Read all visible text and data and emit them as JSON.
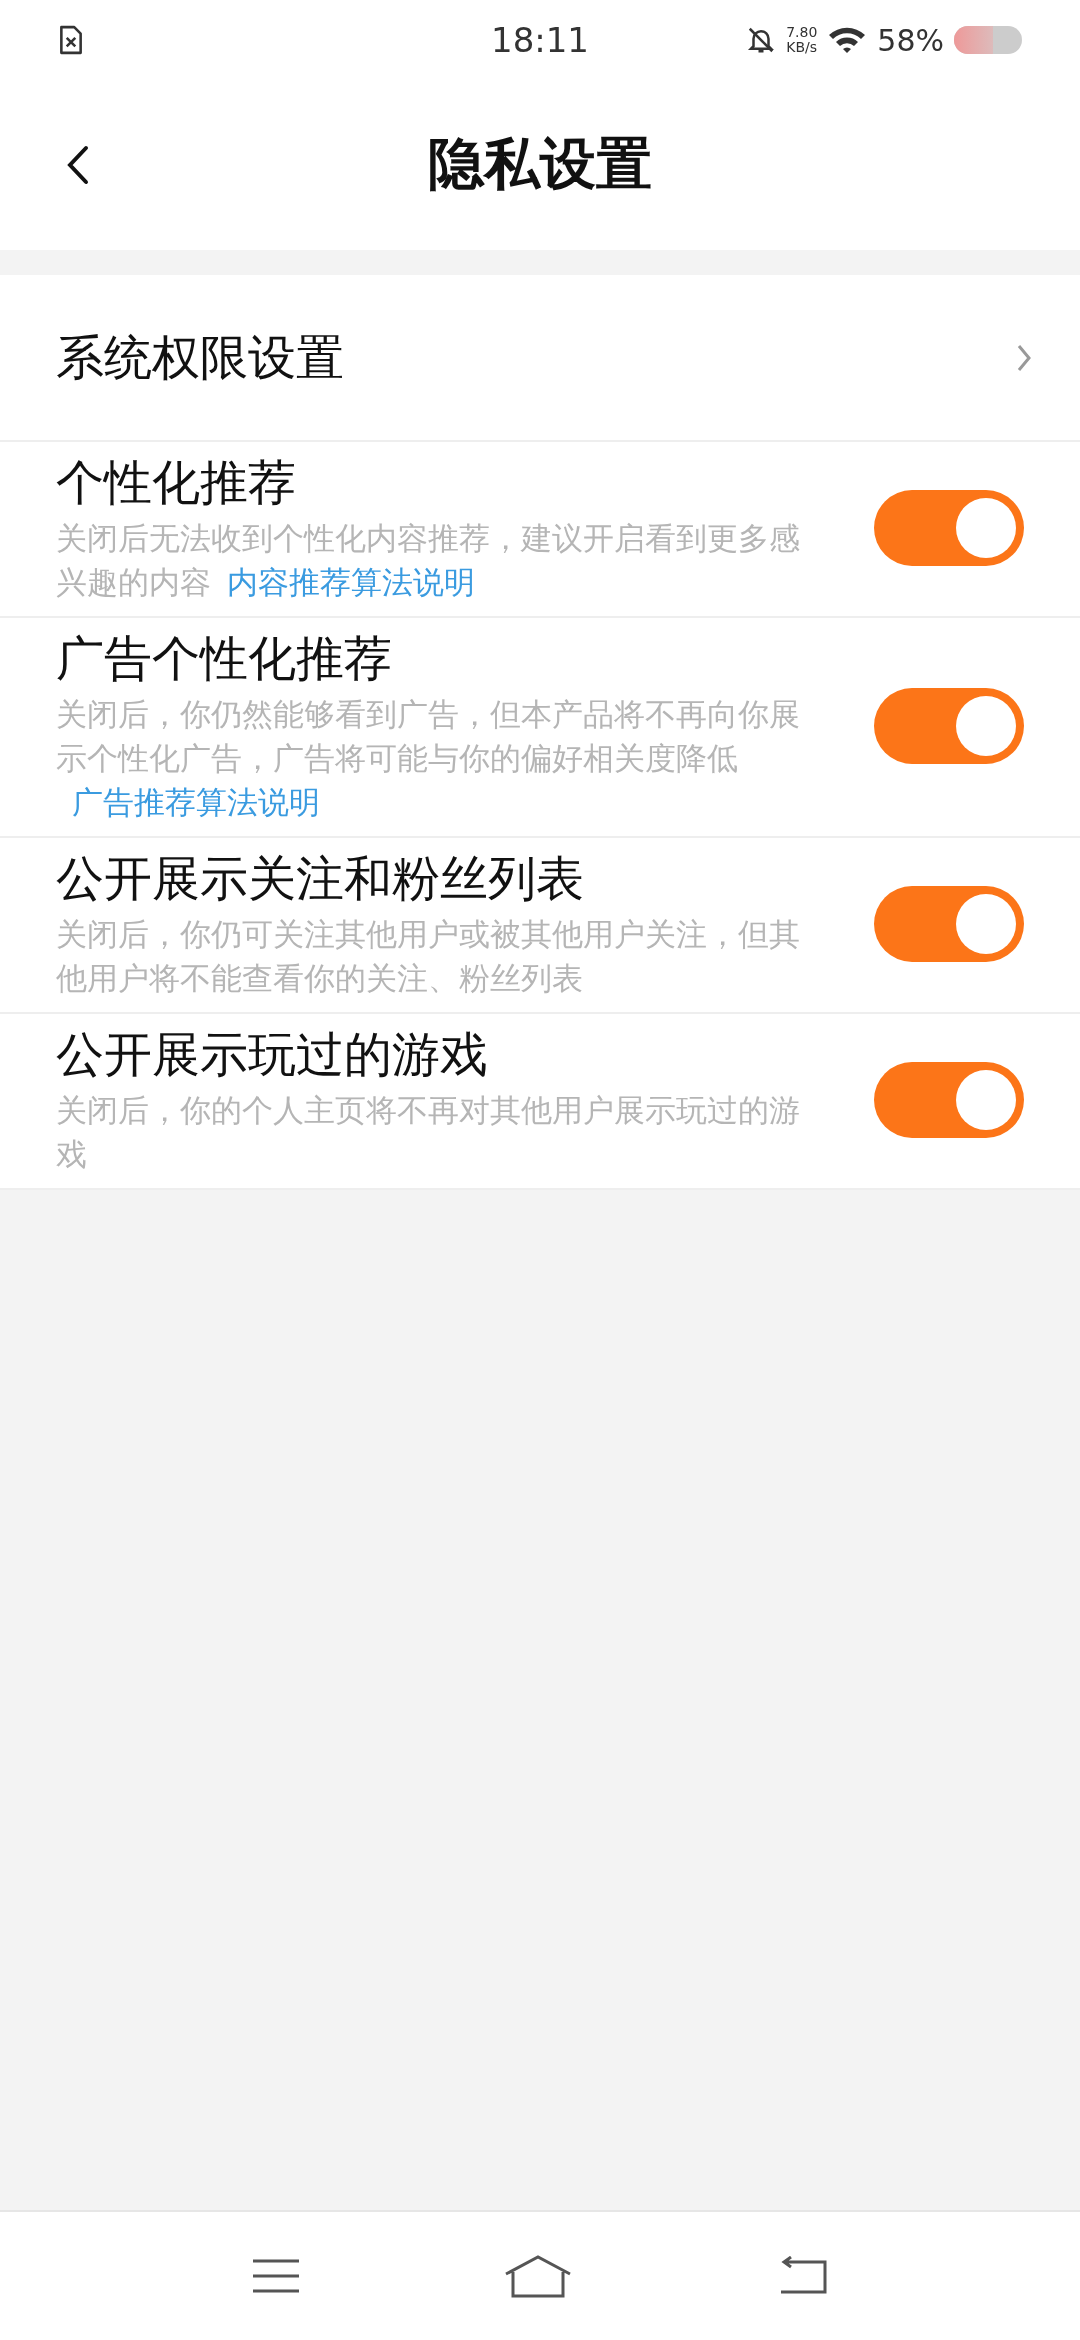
{
  "status_bar": {
    "time": "18:11",
    "speed_value": "7.80",
    "speed_unit": "KB/s",
    "battery": "58%"
  },
  "header": {
    "title": "隐私设置"
  },
  "system_row": {
    "label": "系统权限设置"
  },
  "settings": [
    {
      "title": "个性化推荐",
      "description": "关闭后无法收到个性化内容推荐，建议开启看到更多感兴趣的内容",
      "link": "内容推荐算法说明",
      "on": true
    },
    {
      "title": "广告个性化推荐",
      "description": "关闭后，你仍然能够看到广告，但本产品将不再向你展示个性化广告，广告将可能与你的偏好相关度降低",
      "link": "广告推荐算法说明",
      "on": true
    },
    {
      "title": "公开展示关注和粉丝列表",
      "description": "关闭后，你仍可关注其他用户或被其他用户关注，但其他用户将不能查看你的关注、粉丝列表",
      "on": true
    },
    {
      "title": "公开展示玩过的游戏",
      "description": "关闭后，你的个人主页将不再对其他用户展示玩过的游戏",
      "on": true
    }
  ]
}
